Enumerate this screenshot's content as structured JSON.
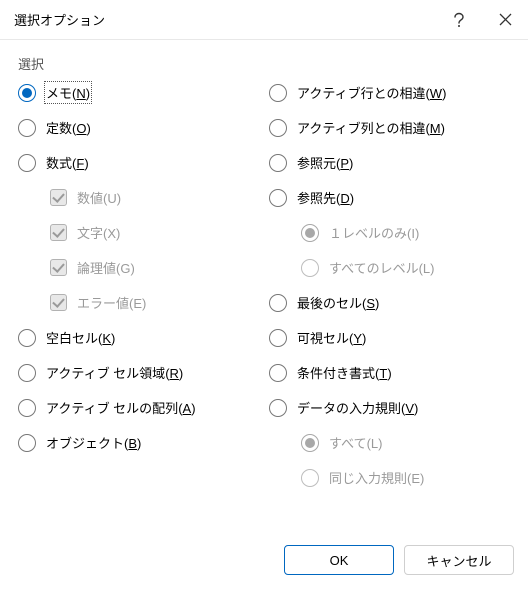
{
  "title": "選択オプション",
  "group_label": "選択",
  "left": {
    "memo": {
      "text": "メモ",
      "accel": "N"
    },
    "constants": {
      "text": "定数",
      "accel": "O"
    },
    "formulas": {
      "text": "数式",
      "accel": "F"
    },
    "numbers": {
      "text": "数値(U)"
    },
    "text": {
      "text": "文字(X)"
    },
    "logicals": {
      "text": "論理値(G)"
    },
    "errors": {
      "text": "エラー値(E)"
    },
    "blanks": {
      "text": "空白セル",
      "accel": "K"
    },
    "current_region": {
      "text": "アクティブ セル領域",
      "accel": "R"
    },
    "current_array": {
      "text": "アクティブ セルの配列",
      "accel": "A"
    },
    "objects": {
      "text": "オブジェクト",
      "accel": "B"
    }
  },
  "right": {
    "row_diffs": {
      "text": "アクティブ行との相違",
      "accel": "W"
    },
    "col_diffs": {
      "text": "アクティブ列との相違",
      "accel": "M"
    },
    "precedents": {
      "text": "参照元",
      "accel": "P"
    },
    "dependents": {
      "text": "参照先",
      "accel": "D"
    },
    "one_level": {
      "text": "１レベルのみ(I)"
    },
    "all_levels": {
      "text": "すべてのレベル(L)"
    },
    "last_cell": {
      "text": "最後のセル",
      "accel": "S"
    },
    "visible": {
      "text": "可視セル",
      "accel": "Y"
    },
    "cond_fmt": {
      "text": "条件付き書式",
      "accel": "T"
    },
    "data_val": {
      "text": "データの入力規則",
      "accel": "V"
    },
    "dv_all": {
      "text": "すべて(L)"
    },
    "dv_same": {
      "text": "同じ入力規則(E)"
    }
  },
  "buttons": {
    "ok": "OK",
    "cancel": "キャンセル"
  }
}
